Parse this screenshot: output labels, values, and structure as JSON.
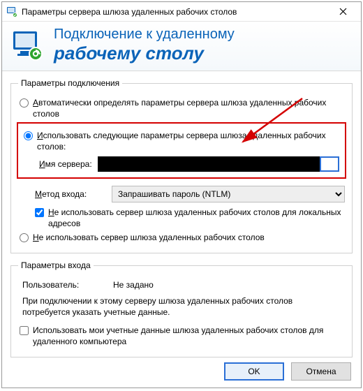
{
  "window": {
    "title": "Параметры сервера шлюза удаленных рабочих столов"
  },
  "header": {
    "line1": "Подключение к удаленному",
    "line2": "рабочему столу"
  },
  "conn": {
    "legend": "Параметры подключения",
    "radio_auto_prefix": "А",
    "radio_auto_rest": "втоматически определять параметры сервера шлюза удаленных рабочих столов",
    "radio_manual_prefix": "И",
    "radio_manual_rest": "спользовать следующие параметры сервера шлюза удаленных рабочих столов:",
    "server_label_prefix": "И",
    "server_label_rest": "мя сервера:",
    "server_value": "",
    "method_label_prefix": "М",
    "method_label_rest": "етод входа:",
    "method_value": "Запрашивать пароль (NTLM)",
    "chk_bypass_prefix": "Н",
    "chk_bypass_rest": "е использовать сервер шлюза удаленных рабочих столов для локальных адресов",
    "radio_none_prefix": "Н",
    "radio_none_rest": "е использовать сервер шлюза удаленных рабочих столов"
  },
  "logon": {
    "legend": "Параметры входа",
    "user_label": "Пользователь:",
    "user_value": "Не задано",
    "note": "При подключении к этому серверу шлюза удаленных рабочих столов потребуется указать учетные данные.",
    "chk_share": "Использовать мои учетные данные шлюза удаленных рабочих столов для удаленного компьютера"
  },
  "buttons": {
    "ok": "OK",
    "cancel": "Отмена"
  }
}
